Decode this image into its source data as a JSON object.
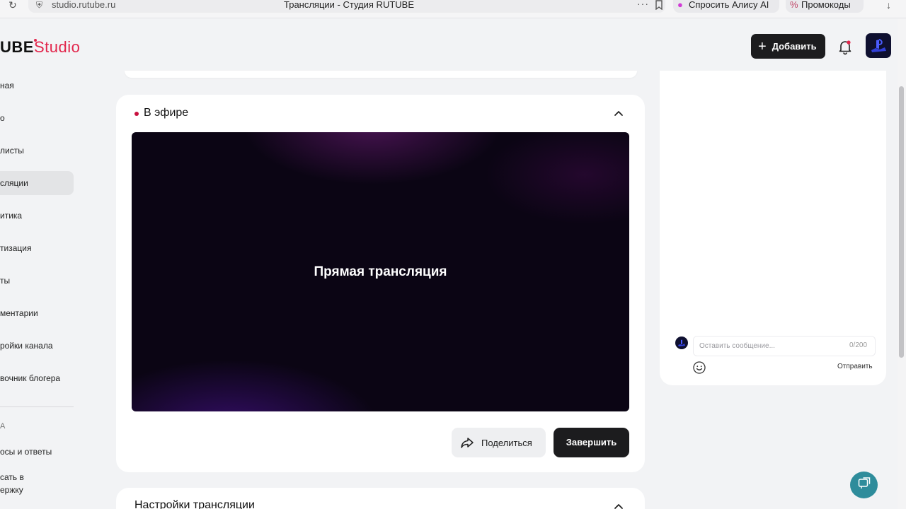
{
  "browser": {
    "url": "studio.rutube.ru",
    "page_title": "Трансляции - Студия RUTUBE",
    "more_label": "···",
    "alice_label": "Спросить Алису AI",
    "promo_label": "Промокоды"
  },
  "header": {
    "logo_rutube": "UBE",
    "logo_studio": "Studio",
    "add_label": "Добавить"
  },
  "sidebar": {
    "items": [
      {
        "label": "ная"
      },
      {
        "label": "о"
      },
      {
        "label": "листы"
      },
      {
        "label": "сляции"
      },
      {
        "label": "итика"
      },
      {
        "label": "тизация"
      },
      {
        "label": "ты"
      },
      {
        "label": "ментарии"
      },
      {
        "label": "ройки канала"
      },
      {
        "label": "вочник блогера"
      }
    ],
    "section_label": "А",
    "help_items": [
      {
        "label": "осы и ответы"
      },
      {
        "label": "сать в"
      },
      {
        "label": "ержку"
      }
    ]
  },
  "live_card": {
    "title": "В эфире",
    "video_label": "Прямая трансляция",
    "share_label": "Поделиться",
    "finish_label": "Завершить"
  },
  "settings_card": {
    "title": "Настройки трансляции"
  },
  "chat": {
    "placeholder": "Оставить сообщение...",
    "counter": "0/200",
    "send_label": "Отправить"
  },
  "colors": {
    "brand_red": "#e2254b",
    "live_dot": "#c8103e",
    "dark_button": "#1c1c1e",
    "support_button": "#2e8c9b"
  }
}
